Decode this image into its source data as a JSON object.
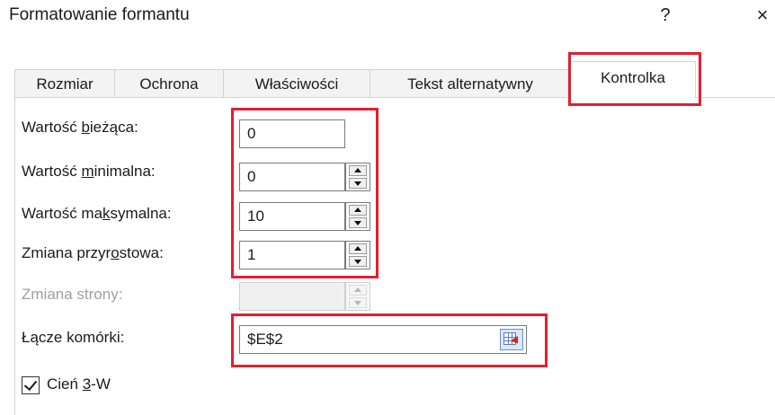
{
  "dialog": {
    "title": "Formatowanie formantu",
    "help_label": "?",
    "close_label": "×"
  },
  "tabs": [
    {
      "label": "Rozmiar",
      "active": false
    },
    {
      "label": "Ochrona",
      "active": false
    },
    {
      "label": "Właściwości",
      "active": false
    },
    {
      "label": "Tekst alternatywny",
      "active": false
    },
    {
      "label": "Kontrolka",
      "active": true
    }
  ],
  "fields": {
    "current_value": {
      "label_pre": "Wartość ",
      "label_acc": "b",
      "label_post": "ieżąca:",
      "value": "0"
    },
    "min_value": {
      "label_pre": "Wartość ",
      "label_acc": "m",
      "label_post": "inimalna:",
      "value": "0"
    },
    "max_value": {
      "label_pre": "Wartość ma",
      "label_acc": "k",
      "label_post": "symalna:",
      "value": "10"
    },
    "incremental_change": {
      "label_pre": "Zmiana przyr",
      "label_acc": "o",
      "label_post": "stowa:",
      "value": "1"
    },
    "page_change": {
      "label": "Zmiana strony:",
      "value": "",
      "disabled": true
    },
    "cell_link": {
      "label": "Łącze komórki:",
      "value": "$E$2"
    }
  },
  "checkbox_3d": {
    "label_pre": "Cień ",
    "label_acc": "3",
    "label_post": "-W",
    "checked": true
  },
  "highlight_color": "#e0202f"
}
